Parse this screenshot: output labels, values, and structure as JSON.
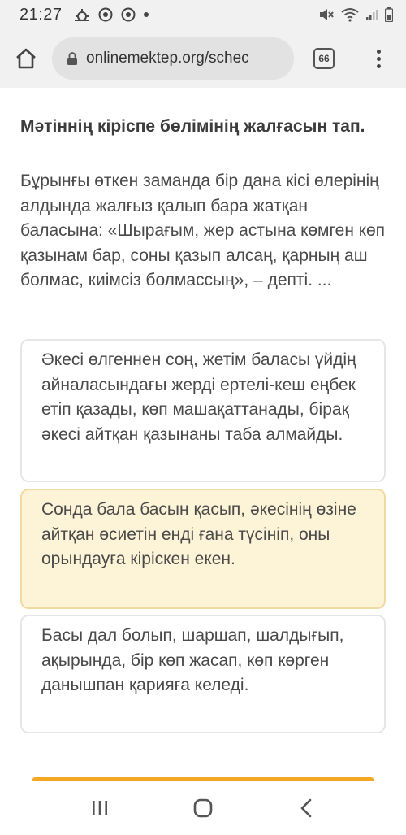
{
  "status_bar": {
    "time": "21:27",
    "icons_left": [
      "weather-icon",
      "chrome-icon",
      "chrome-icon",
      "notification-dot"
    ],
    "icons_right": [
      "mute-icon",
      "wifi-icon",
      "signal-icon",
      "battery-icon"
    ]
  },
  "browser": {
    "url": "onlinemektep.org/schec",
    "tab_count": "66"
  },
  "quiz": {
    "question": "Мәтіннің кіріспе бөлімінің жалғасын тап.",
    "passage": "Бұрынғы өткен заманда бір дана кісі өлерінің алдында жалғыз қалып бара жатқан баласына: «Шырағым, жер астына көмген көп қазынам бар, соны қазып алсаң, қарның аш болмас, киімсіз болмассың», – депті. ...",
    "options": [
      {
        "text": "Әкесі өлгеннен соң, жетім баласы үйдің айналасындағы жерді ертелі-кеш еңбек етіп қазады, көп машақаттанады, бірақ әкесі айтқан қазынаны таба алмайды.",
        "selected": false
      },
      {
        "text": "Сонда бала басын қасып, әкесінің өзіне айтқан өсиетін енді ғана түсініп, оны орындауға кіріскен екен.",
        "selected": true
      },
      {
        "text": "Басы дал болып, шаршап, шалдығып, ақырында, бір көп жасап, көп көрген данышпан қарияға келеді.",
        "selected": false
      }
    ]
  },
  "colors": {
    "selected_bg": "#fdf3d6",
    "selected_border": "#f2d9a0",
    "accent": "#f5a623"
  }
}
